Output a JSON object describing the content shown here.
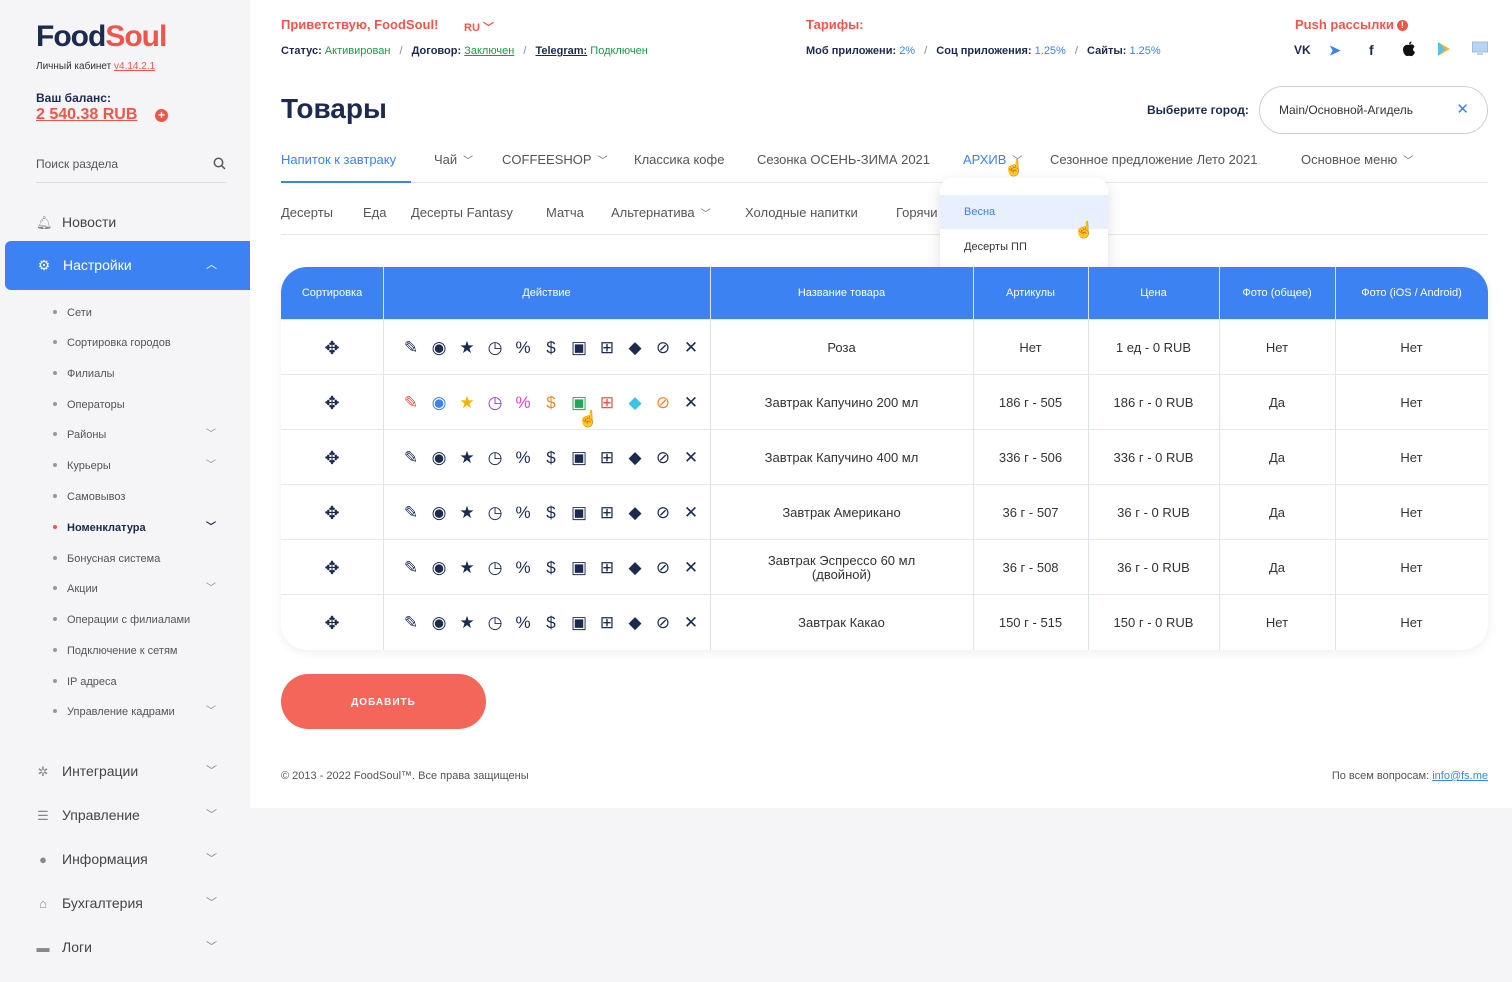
{
  "brand": {
    "part1": "Food",
    "part2": "Soul",
    "cabinet_label": "Личный кабинет",
    "version": "v4.14.2.1"
  },
  "balance": {
    "label": "Ваш баланс:",
    "value": "2 540.38 RUB"
  },
  "sidebar_search": {
    "placeholder": "Поиск раздела"
  },
  "nav": {
    "news": "Новости",
    "settings": "Настройки",
    "settings_sub": [
      "Сети",
      "Сортировка городов",
      "Филиалы",
      "Операторы",
      "Районы",
      "Курьеры",
      "Самовывоз",
      "Номенклатура",
      "Бонусная система",
      "Акции",
      "Операции с филиалами",
      "Подключение к сетям",
      "IP адреса",
      "Управление кадрами"
    ],
    "integrations": "Интеграции",
    "management": "Управление",
    "info": "Информация",
    "accounting": "Бухгалтерия",
    "logs": "Логи"
  },
  "header": {
    "greeting": "Приветствую, FoodSoul!",
    "lang": "RU",
    "status_label": "Статус:",
    "status_value": "Активирован",
    "contract_label": "Договор:",
    "contract_value": "Заключен",
    "telegram_label": "Telegram:",
    "telegram_value": "Подключен",
    "tariffs_title": "Тарифы:",
    "mob_label": "Моб приложени:",
    "mob_value": "2%",
    "soc_label": "Соц приложения:",
    "soc_value": "1.25%",
    "sites_label": "Сайты:",
    "sites_value": "1.25%",
    "push_title": "Push рассылки",
    "social": {
      "vk": "VK"
    }
  },
  "page": {
    "title": "Товары",
    "city_label": "Выберите город:",
    "city_value": "Main/Основной-Агидель"
  },
  "tabs_row1": [
    "Напиток к завтраку",
    "Чай",
    "COFFEESHOP",
    "Классика кофе",
    "Сезонка ОСЕНЬ-ЗИМА 2021",
    "АРХИВ",
    "Сезонное предложение Лето 2021",
    "Основное меню"
  ],
  "tabs_row2": [
    "Десерты",
    "Еда",
    "Десерты Fantasy",
    "Матча",
    "Альтернатива",
    "Холодные напитки",
    "Горячи"
  ],
  "dropdown": [
    "Весна",
    "Десерты ПП"
  ],
  "table": {
    "headers": [
      "Сортировка",
      "Действие",
      "Название товара",
      "Артикулы",
      "Цена",
      "Фото (общее)",
      "Фото (iOS / Android)"
    ],
    "rows": [
      {
        "name": "Роза",
        "article": "Нет",
        "price": "1 ед - 0 RUB",
        "photo": "Нет",
        "photo_mobile": "Нет"
      },
      {
        "name": "Завтрак Капучино 200 мл",
        "article": "186 г - 505",
        "price": "186 г - 0 RUB",
        "photo": "Да",
        "photo_mobile": "Нет"
      },
      {
        "name": "Завтрак Капучино 400 мл",
        "article": "336 г - 506",
        "price": "336 г - 0 RUB",
        "photo": "Да",
        "photo_mobile": "Нет"
      },
      {
        "name": "Завтрак Американо",
        "article": "36 г - 507",
        "price": "36 г - 0 RUB",
        "photo": "Да",
        "photo_mobile": "Нет"
      },
      {
        "name": "Завтрак Эспрессо 60 мл (двойной)",
        "article": "36 г - 508",
        "price": "36 г - 0 RUB",
        "photo": "Да",
        "photo_mobile": "Нет"
      },
      {
        "name": "Завтрак Какао",
        "article": "150 г - 515",
        "price": "150 г - 0 RUB",
        "photo": "Нет",
        "photo_mobile": "Нет"
      }
    ],
    "action_icons": [
      "edit-icon",
      "view-icon",
      "star-icon",
      "speed-icon",
      "percent-icon",
      "coin-icon",
      "gift-box-icon",
      "gift-icon",
      "diamond-icon",
      "no-money-icon",
      "close-icon"
    ],
    "highlight_colors": [
      "#f0554a",
      "#3c82f3",
      "#f5b400",
      "#9b3fd6",
      "#e83fc8",
      "#f2882a",
      "#1fa85a",
      "#f0554a",
      "#3ec3e8",
      "#f2882a",
      "#1b2a4e"
    ]
  },
  "add_button": "ДОБАВИТЬ",
  "footer": {
    "copyright": "© 2013 - 2022 FoodSoul™. Все права защищены",
    "contact_label": "По всем вопросам:",
    "contact_email": "info@fs.me"
  },
  "colors": {
    "accent": "#3c82f3",
    "brand": "#f0554a",
    "dark": "#1b2a4e",
    "green": "#1a9a4a"
  }
}
